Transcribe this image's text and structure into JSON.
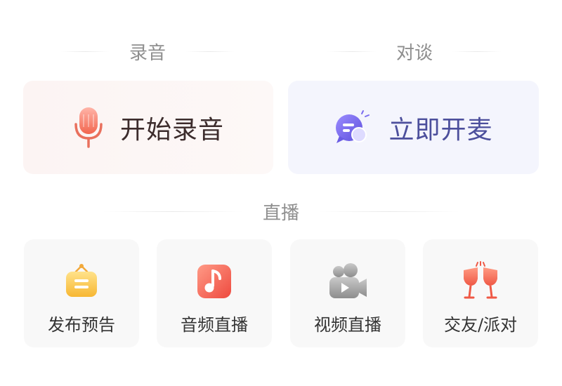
{
  "sections": {
    "record": "录音",
    "talk": "对谈",
    "live": "直播"
  },
  "cards": {
    "record": {
      "label": "开始录音",
      "icon": "microphone-icon"
    },
    "talk": {
      "label": "立即开麦",
      "icon": "chat-bubble-icon"
    }
  },
  "live_items": [
    {
      "label": "发布预告",
      "icon": "announcement-board-icon"
    },
    {
      "label": "音频直播",
      "icon": "music-note-icon"
    },
    {
      "label": "视频直播",
      "icon": "video-camera-icon"
    },
    {
      "label": "交友/派对",
      "icon": "cheers-glasses-icon"
    }
  ],
  "colors": {
    "record_text": "#3c2c2c",
    "talk_text": "#4c4f9c",
    "section_title": "#8f8f8f"
  }
}
